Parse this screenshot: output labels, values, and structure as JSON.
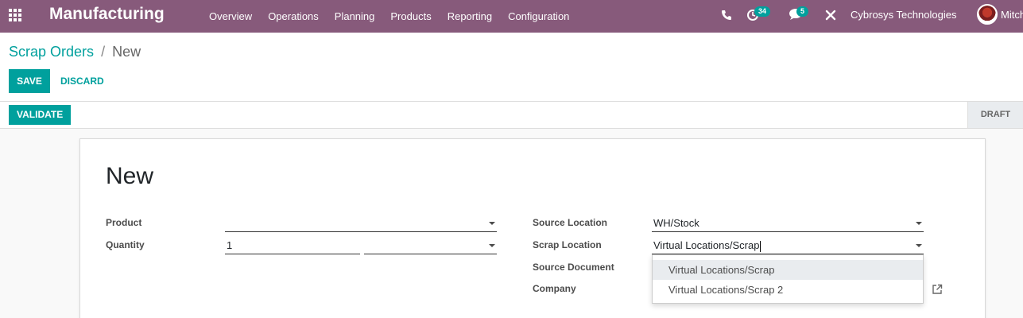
{
  "navbar": {
    "app_name": "Manufacturing",
    "menu": [
      "Overview",
      "Operations",
      "Planning",
      "Products",
      "Reporting",
      "Configuration"
    ],
    "activity_count": "34",
    "message_count": "5",
    "company": "Cybrosys Technologies",
    "user": "Mitch"
  },
  "breadcrumb": {
    "parent": "Scrap Orders",
    "separator": "/",
    "current": "New"
  },
  "buttons": {
    "save": "SAVE",
    "discard": "DISCARD",
    "validate": "VALIDATE"
  },
  "status": {
    "stage": "DRAFT"
  },
  "form": {
    "title": "New",
    "left": {
      "product_label": "Product",
      "product_value": "",
      "quantity_label": "Quantity",
      "quantity_value": "1",
      "uom_value": ""
    },
    "right": {
      "source_location_label": "Source Location",
      "source_location_value": "WH/Stock",
      "scrap_location_label": "Scrap Location",
      "scrap_location_value": "Virtual Locations/Scrap",
      "source_document_label": "Source Document",
      "company_label": "Company"
    }
  },
  "dropdown": {
    "options": [
      "Virtual Locations/Scrap",
      "Virtual Locations/Scrap 2"
    ],
    "highlighted_index": 0
  },
  "colors": {
    "navbar": "#875a7b",
    "primary": "#00a09d"
  }
}
